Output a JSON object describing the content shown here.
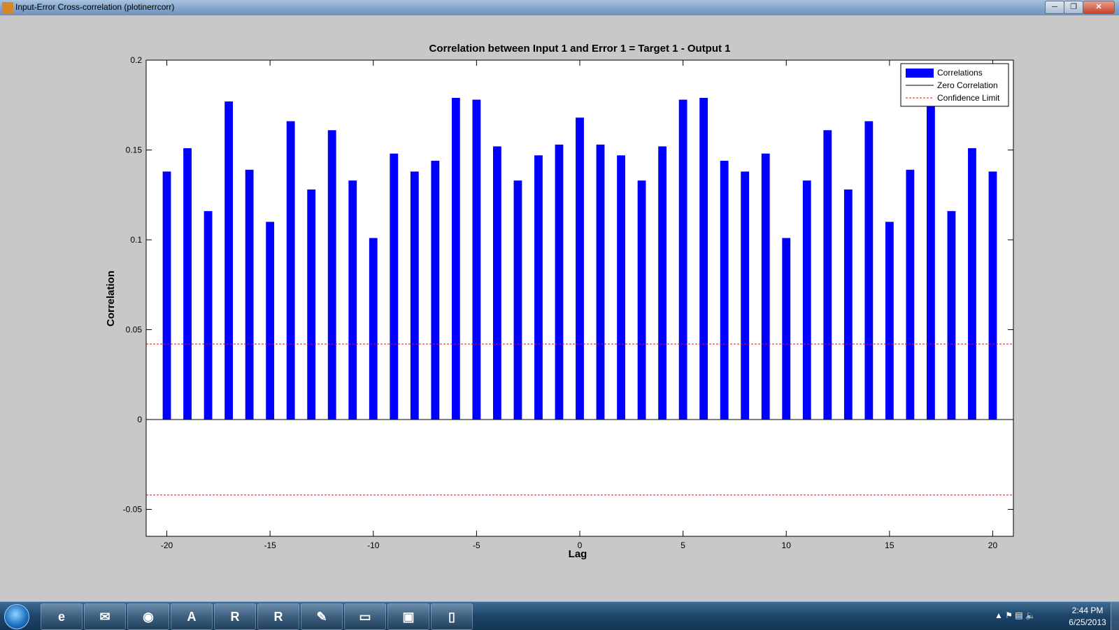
{
  "window": {
    "title": "Input-Error Cross-correlation (plotinerrcorr)",
    "minimize": "─",
    "maximize": "❐",
    "close": "✕"
  },
  "chart_data": {
    "type": "bar",
    "title": "Correlation between Input 1 and Error 1 = Target 1 - Output 1",
    "xlabel": "Lag",
    "ylabel": "Correlation",
    "xlim": [
      -21,
      21
    ],
    "ylim": [
      -0.065,
      0.2
    ],
    "x_ticks": [
      -20,
      -15,
      -10,
      -5,
      0,
      5,
      10,
      15,
      20
    ],
    "y_ticks": [
      -0.05,
      0,
      0.05,
      0.1,
      0.15,
      0.2
    ],
    "y_tick_labels": [
      "-0.05",
      "0",
      "0.05",
      "0.1",
      "0.15",
      "0.2"
    ],
    "x": [
      -20,
      -19,
      -18,
      -17,
      -16,
      -15,
      -14,
      -13,
      -12,
      -11,
      -10,
      -9,
      -8,
      -7,
      -6,
      -5,
      -4,
      -3,
      -2,
      -1,
      0,
      1,
      2,
      3,
      4,
      5,
      6,
      7,
      8,
      9,
      10,
      11,
      12,
      13,
      14,
      15,
      16,
      17,
      18,
      19,
      20
    ],
    "values": [
      0.138,
      0.151,
      0.116,
      0.177,
      0.139,
      0.11,
      0.166,
      0.128,
      0.161,
      0.133,
      0.101,
      0.148,
      0.138,
      0.144,
      0.179,
      0.178,
      0.152,
      0.133,
      0.147,
      0.153,
      0.168,
      0.153,
      0.147,
      0.133,
      0.152,
      0.178,
      0.179,
      0.144,
      0.138,
      0.148,
      0.101,
      0.133,
      0.161,
      0.128,
      0.166,
      0.11,
      0.139,
      0.177,
      0.116,
      0.151,
      0.138
    ],
    "confidence_limit": 0.042,
    "grid": false,
    "legend_position": "top-right",
    "legend": [
      {
        "label": "Correlations",
        "style": "bar",
        "color": "#0000ff"
      },
      {
        "label": "Zero Correlation",
        "style": "solid",
        "color": "#000000"
      },
      {
        "label": "Confidence Limit",
        "style": "dashed",
        "color": "#ff0000"
      }
    ],
    "colors": {
      "bars": "#0000ff",
      "zero": "#000000",
      "limit": "#ff0000"
    }
  },
  "taskbar": {
    "apps": [
      {
        "name": "internet-explorer",
        "glyph": "e"
      },
      {
        "name": "outlook",
        "glyph": "✉"
      },
      {
        "name": "firefox",
        "glyph": "◉"
      },
      {
        "name": "acrobat",
        "glyph": "A"
      },
      {
        "name": "r-console",
        "glyph": "R"
      },
      {
        "name": "rstudio",
        "glyph": "R"
      },
      {
        "name": "matlab-editor",
        "glyph": "✎"
      },
      {
        "name": "documents",
        "glyph": "▭"
      },
      {
        "name": "image-viewer",
        "glyph": "▣"
      },
      {
        "name": "blank-file",
        "glyph": "▯"
      }
    ],
    "tray": "▲  ⚑  ▤  🔈",
    "time": "2:44 PM",
    "date": "6/25/2013"
  }
}
